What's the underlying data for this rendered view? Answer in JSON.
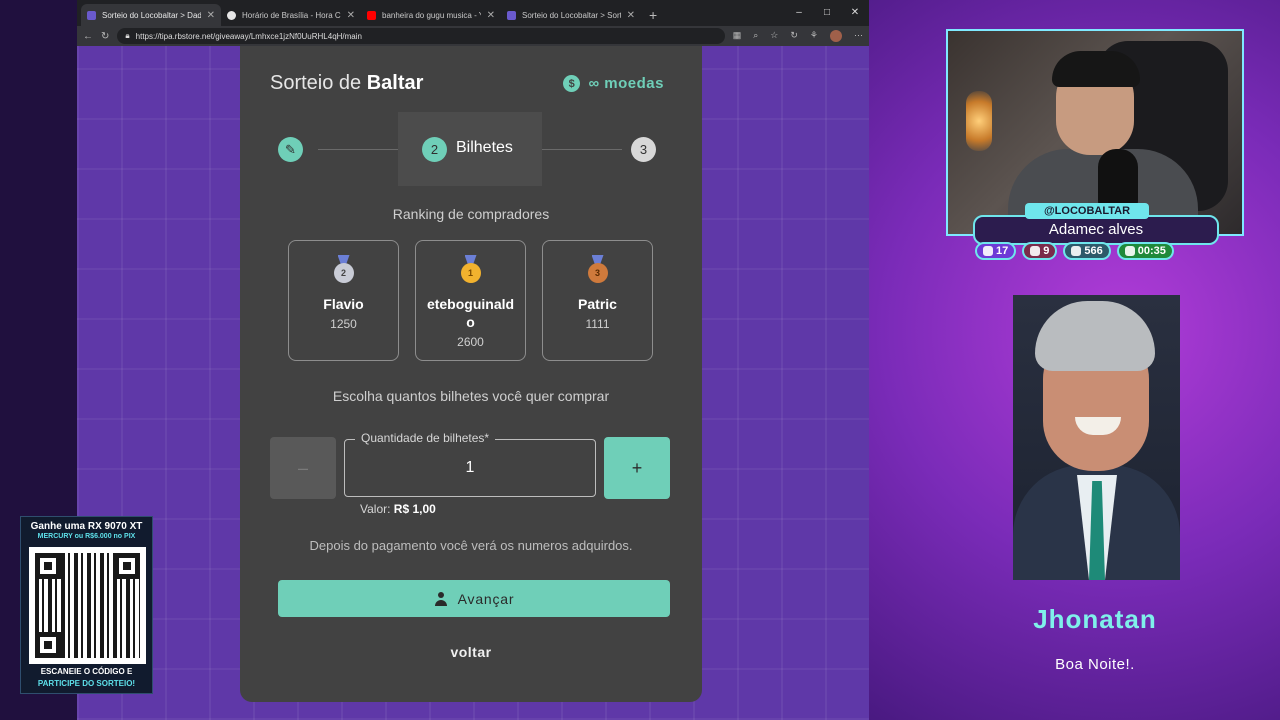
{
  "browser": {
    "tabs": [
      {
        "title": "Sorteio do Locobaltar > Dados | T",
        "favicon_color": "#6a5acd",
        "active": true
      },
      {
        "title": "Horário de Brasília - Hora Certa O",
        "favicon_color": "#e6e6e6",
        "active": false
      },
      {
        "title": "banheira do gugu musica - YouTu",
        "favicon_color": "#ff0000",
        "active": false
      },
      {
        "title": "Sorteio do Locobaltar > Sortear |",
        "favicon_color": "#6a5acd",
        "active": false
      }
    ],
    "new_tab": "+",
    "url": "https://tipa.rbstore.net/giveaway/Lmhxce1jzNf0UuRHL4qH/main"
  },
  "giveaway": {
    "title_prefix": "Sorteio de ",
    "title_name": "Baltar",
    "coins_icon": "$",
    "coins_label": "∞ moedas",
    "steps": {
      "edit_icon": "✎",
      "current_number": "2",
      "current_label": "Bilhetes",
      "last_number": "3"
    },
    "ranking_title": "Ranking de compradores",
    "ranking": [
      {
        "place": "2",
        "name": "Flavio",
        "score": "1250",
        "medal": "silver"
      },
      {
        "place": "1",
        "name": "eteboguinaldo",
        "score": "2600",
        "medal": "gold"
      },
      {
        "place": "3",
        "name": "Patric",
        "score": "1111",
        "medal": "bronze"
      }
    ],
    "choose_title": "Escolha quantos bilhetes você quer comprar",
    "quantity_label": "Quantidade de bilhetes*",
    "quantity_value": "1",
    "minus_label": "–",
    "plus_label": "+",
    "price_label": "Valor: ",
    "price_value": "R$ 1,00",
    "after_note": "Depois do pagamento você verá os numeros adquirdos.",
    "next_label": "Avançar",
    "back_label": "voltar"
  },
  "overlay": {
    "handle": "@LOCOBALTAR",
    "viewer_name": "Adamec alves",
    "stats": [
      {
        "platform": "twitch",
        "value": "17"
      },
      {
        "platform": "youtube",
        "value": "9"
      },
      {
        "platform": "kick",
        "value": "566"
      },
      {
        "platform": "clock",
        "value": "00:35"
      }
    ],
    "alert_name": "Jhonatan",
    "alert_message": "Boa Noite!.",
    "promo_line1": "Ganhe uma RX 9070 XT",
    "promo_line2": "MERCURY ou R$6.000 no PIX",
    "promo_line3": "ESCANEIE O CÓDIGO E",
    "promo_line4": "PARTICIPE DO SORTEIO!"
  },
  "colors": {
    "accent": "#6fcfb8",
    "card_bg": "#424242",
    "page_bg": "#5f38a8",
    "overlay_cyan": "#6fe6ec"
  }
}
